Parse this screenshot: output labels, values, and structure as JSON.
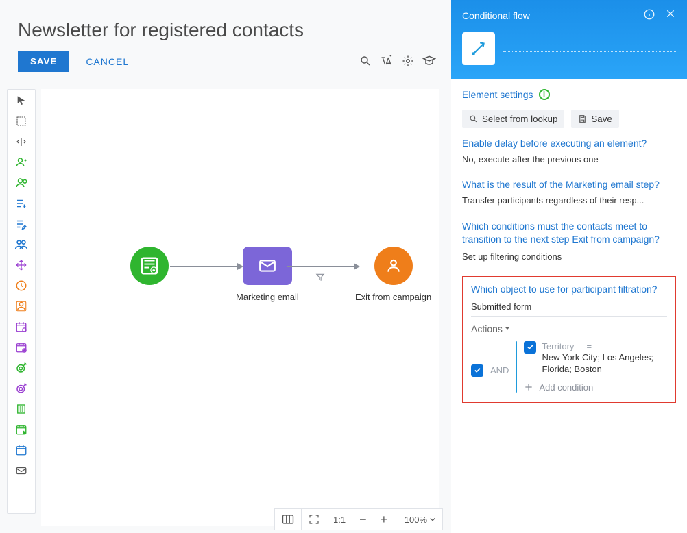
{
  "page": {
    "title": "Newsletter for registered contacts"
  },
  "header": {
    "save": "SAVE",
    "cancel": "CANCEL"
  },
  "canvas": {
    "nodes": {
      "start": {
        "label": ""
      },
      "email": {
        "label": "Marketing email"
      },
      "exit": {
        "label": "Exit from campaign"
      }
    }
  },
  "zoom": {
    "fit": "1:1",
    "percent": "100%"
  },
  "panel": {
    "title": "Conditional flow",
    "element_settings": "Element settings",
    "select_from_lookup": "Select from lookup",
    "save": "Save",
    "q_delay": "Enable delay before executing an element?",
    "a_delay": "No, execute after the previous one",
    "q_result": "What is the result of the Marketing email step?",
    "a_result": "Transfer participants regardless of their resp...",
    "q_cond": "Which conditions must the contacts meet to transition to the next step Exit from campaign?",
    "a_cond": "Set up filtering conditions",
    "q_object": "Which object to use for participant filtration?",
    "a_object": "Submitted form",
    "actions": "Actions",
    "and": "AND",
    "cond_name": "Territory",
    "cond_op": "=",
    "cond_val": "New York City; Los Angeles; Florida; Boston",
    "add_condition": "Add condition"
  }
}
